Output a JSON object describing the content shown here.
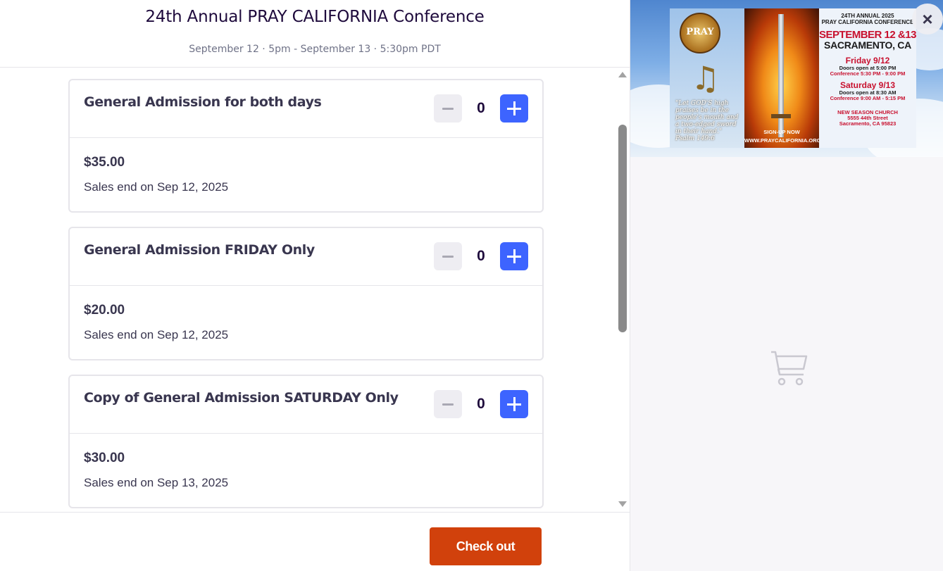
{
  "event": {
    "title": "24th Annual PRAY CALIFORNIA Conference",
    "dates": "September 12 · 5pm - September 13 · 5:30pm PDT"
  },
  "tickets": [
    {
      "name": "General Admission for both days",
      "quantity": "0",
      "price": "$35.00",
      "sales_end": "Sales end on Sep 12, 2025"
    },
    {
      "name": "General Admission FRIDAY Only",
      "quantity": "0",
      "price": "$20.00",
      "sales_end": "Sales end on Sep 12, 2025"
    },
    {
      "name": "Copy of General Admission SATURDAY Only",
      "quantity": "0",
      "price": "$30.00",
      "sales_end": "Sales end on Sep 13, 2025"
    }
  ],
  "footer": {
    "checkout_label": "Check out"
  },
  "banner": {
    "logo_text": "PRAY",
    "verse": "\"Let GOD'S high praises be in the people's mouth and a two-edged sword in their hand.\"",
    "verse_ref": "Psalm 149:6",
    "signup": "SIGN-UP NOW",
    "website": "WWW.PRAYCALIFORNIA.ORG",
    "heading_line1": "24TH ANNUAL 2025",
    "heading_line2": "PRAY CALIFORNIA CONFERENCE",
    "dates": "SEPTEMBER 12 &13",
    "city": "SACRAMENTO, CA",
    "friday": "Friday 9/12",
    "friday_doors": "Doors open at 5:00 PM",
    "friday_conf": "Conference 5:30 PM - 9:00 PM",
    "saturday": "Saturday 9/13",
    "saturday_doors": "Doors open at 8:30 AM",
    "saturday_conf": "Conference 9:00 AM - 5:15 PM",
    "venue": "NEW SEASON CHURCH",
    "street": "5555 44th Street",
    "address": "Sacramento, CA 95823"
  },
  "icons": {
    "close": "close-icon",
    "cart": "shopping-cart-icon"
  },
  "colors": {
    "accent": "#3d64ff",
    "checkout": "#d1410c",
    "text": "#39364f"
  }
}
